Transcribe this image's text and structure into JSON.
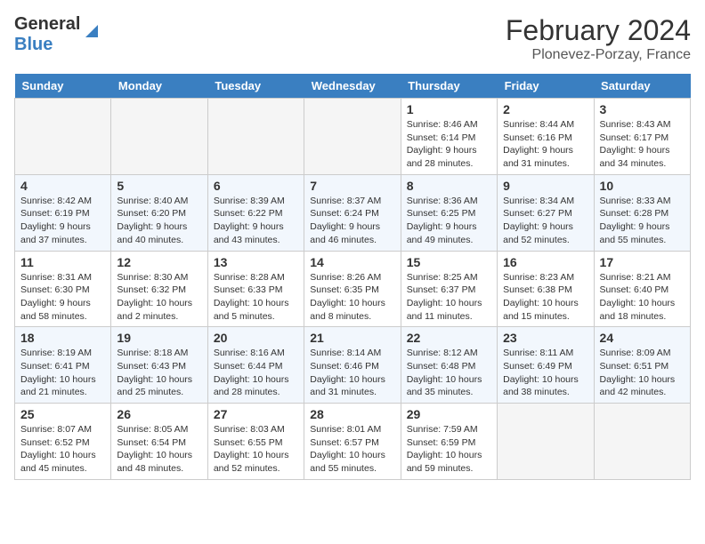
{
  "header": {
    "logo_line1": "General",
    "logo_line2": "Blue",
    "title": "February 2024",
    "subtitle": "Plonevez-Porzay, France"
  },
  "days_of_week": [
    "Sunday",
    "Monday",
    "Tuesday",
    "Wednesday",
    "Thursday",
    "Friday",
    "Saturday"
  ],
  "weeks": [
    [
      {
        "day": "",
        "info": ""
      },
      {
        "day": "",
        "info": ""
      },
      {
        "day": "",
        "info": ""
      },
      {
        "day": "",
        "info": ""
      },
      {
        "day": "1",
        "info": "Sunrise: 8:46 AM\nSunset: 6:14 PM\nDaylight: 9 hours\nand 28 minutes."
      },
      {
        "day": "2",
        "info": "Sunrise: 8:44 AM\nSunset: 6:16 PM\nDaylight: 9 hours\nand 31 minutes."
      },
      {
        "day": "3",
        "info": "Sunrise: 8:43 AM\nSunset: 6:17 PM\nDaylight: 9 hours\nand 34 minutes."
      }
    ],
    [
      {
        "day": "4",
        "info": "Sunrise: 8:42 AM\nSunset: 6:19 PM\nDaylight: 9 hours\nand 37 minutes."
      },
      {
        "day": "5",
        "info": "Sunrise: 8:40 AM\nSunset: 6:20 PM\nDaylight: 9 hours\nand 40 minutes."
      },
      {
        "day": "6",
        "info": "Sunrise: 8:39 AM\nSunset: 6:22 PM\nDaylight: 9 hours\nand 43 minutes."
      },
      {
        "day": "7",
        "info": "Sunrise: 8:37 AM\nSunset: 6:24 PM\nDaylight: 9 hours\nand 46 minutes."
      },
      {
        "day": "8",
        "info": "Sunrise: 8:36 AM\nSunset: 6:25 PM\nDaylight: 9 hours\nand 49 minutes."
      },
      {
        "day": "9",
        "info": "Sunrise: 8:34 AM\nSunset: 6:27 PM\nDaylight: 9 hours\nand 52 minutes."
      },
      {
        "day": "10",
        "info": "Sunrise: 8:33 AM\nSunset: 6:28 PM\nDaylight: 9 hours\nand 55 minutes."
      }
    ],
    [
      {
        "day": "11",
        "info": "Sunrise: 8:31 AM\nSunset: 6:30 PM\nDaylight: 9 hours\nand 58 minutes."
      },
      {
        "day": "12",
        "info": "Sunrise: 8:30 AM\nSunset: 6:32 PM\nDaylight: 10 hours\nand 2 minutes."
      },
      {
        "day": "13",
        "info": "Sunrise: 8:28 AM\nSunset: 6:33 PM\nDaylight: 10 hours\nand 5 minutes."
      },
      {
        "day": "14",
        "info": "Sunrise: 8:26 AM\nSunset: 6:35 PM\nDaylight: 10 hours\nand 8 minutes."
      },
      {
        "day": "15",
        "info": "Sunrise: 8:25 AM\nSunset: 6:37 PM\nDaylight: 10 hours\nand 11 minutes."
      },
      {
        "day": "16",
        "info": "Sunrise: 8:23 AM\nSunset: 6:38 PM\nDaylight: 10 hours\nand 15 minutes."
      },
      {
        "day": "17",
        "info": "Sunrise: 8:21 AM\nSunset: 6:40 PM\nDaylight: 10 hours\nand 18 minutes."
      }
    ],
    [
      {
        "day": "18",
        "info": "Sunrise: 8:19 AM\nSunset: 6:41 PM\nDaylight: 10 hours\nand 21 minutes."
      },
      {
        "day": "19",
        "info": "Sunrise: 8:18 AM\nSunset: 6:43 PM\nDaylight: 10 hours\nand 25 minutes."
      },
      {
        "day": "20",
        "info": "Sunrise: 8:16 AM\nSunset: 6:44 PM\nDaylight: 10 hours\nand 28 minutes."
      },
      {
        "day": "21",
        "info": "Sunrise: 8:14 AM\nSunset: 6:46 PM\nDaylight: 10 hours\nand 31 minutes."
      },
      {
        "day": "22",
        "info": "Sunrise: 8:12 AM\nSunset: 6:48 PM\nDaylight: 10 hours\nand 35 minutes."
      },
      {
        "day": "23",
        "info": "Sunrise: 8:11 AM\nSunset: 6:49 PM\nDaylight: 10 hours\nand 38 minutes."
      },
      {
        "day": "24",
        "info": "Sunrise: 8:09 AM\nSunset: 6:51 PM\nDaylight: 10 hours\nand 42 minutes."
      }
    ],
    [
      {
        "day": "25",
        "info": "Sunrise: 8:07 AM\nSunset: 6:52 PM\nDaylight: 10 hours\nand 45 minutes."
      },
      {
        "day": "26",
        "info": "Sunrise: 8:05 AM\nSunset: 6:54 PM\nDaylight: 10 hours\nand 48 minutes."
      },
      {
        "day": "27",
        "info": "Sunrise: 8:03 AM\nSunset: 6:55 PM\nDaylight: 10 hours\nand 52 minutes."
      },
      {
        "day": "28",
        "info": "Sunrise: 8:01 AM\nSunset: 6:57 PM\nDaylight: 10 hours\nand 55 minutes."
      },
      {
        "day": "29",
        "info": "Sunrise: 7:59 AM\nSunset: 6:59 PM\nDaylight: 10 hours\nand 59 minutes."
      },
      {
        "day": "",
        "info": ""
      },
      {
        "day": "",
        "info": ""
      }
    ]
  ]
}
